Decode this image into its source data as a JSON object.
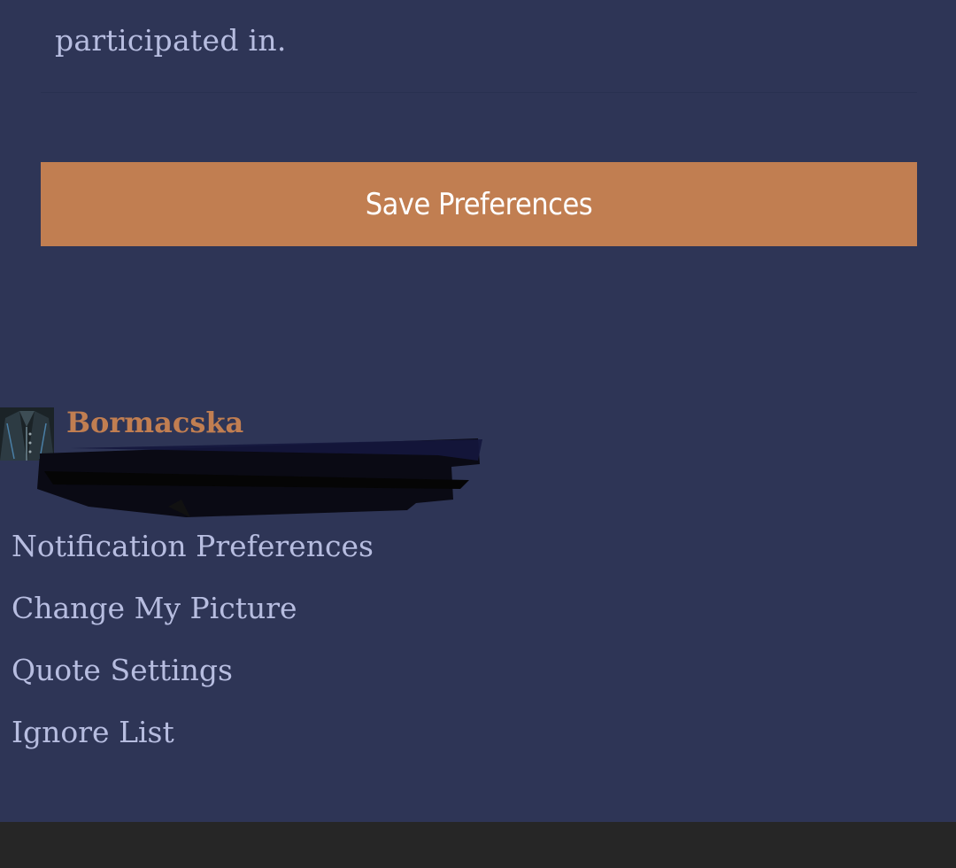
{
  "intro": {
    "text": "participated in."
  },
  "save_button": {
    "label": "Save Preferences"
  },
  "colors": {
    "background": "#2e3556",
    "accent": "#c17e51",
    "text": "#b7bde0",
    "footer": "#262626"
  },
  "user": {
    "name": "Bormacska",
    "avatar_icon": "avatar-icon"
  },
  "menu": {
    "items": [
      {
        "label": "Notification Preferences"
      },
      {
        "label": "Change My Picture"
      },
      {
        "label": "Quote Settings"
      },
      {
        "label": "Ignore List"
      }
    ]
  }
}
